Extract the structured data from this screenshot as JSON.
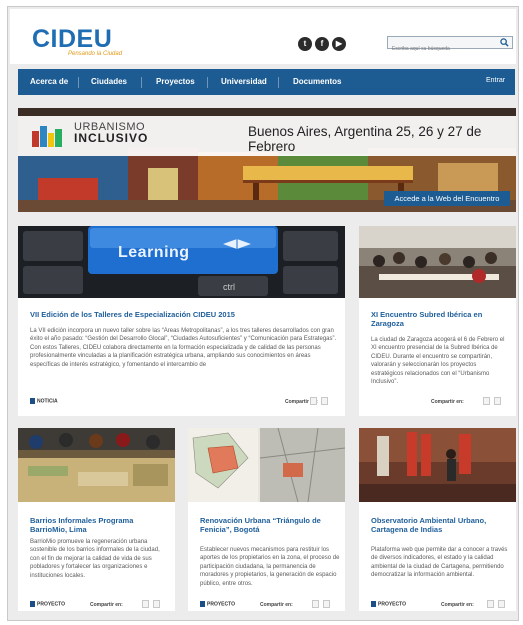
{
  "header": {
    "logo_text_a": "CI",
    "logo_text_b": "DEU",
    "tagline": "Pensando la Ciudad",
    "social": [
      "t",
      "f",
      "▶"
    ],
    "search_placeholder": "Escriba aquí su búsqueda"
  },
  "nav": {
    "items": [
      "Acerca de",
      "Ciudades",
      "Proyectos",
      "Universidad",
      "Documentos"
    ],
    "login": "Entrar"
  },
  "banner": {
    "line1": "URBANISMO",
    "line2": "INCLUSIVO",
    "location": "Buenos Aires, Argentina 25, 26 y 27 de Febrero",
    "cta": "Accede a la Web del Encuentro"
  },
  "cards": [
    {
      "image_text": "Learning",
      "image_key": "ctrl",
      "title": "VII Edición de los Talleres de Especialización CIDEU 2015",
      "desc": "La VII edición incorpora un nuevo taller sobre las “Áreas Metropolitanas”, a los tres talleres desarrollados con gran éxito el año pasado: “Gestión del Desarrollo Glocal”, “Ciudades Autosuficientes” y “Comunicación para Estrategas”. Con estos Talleres, CIDEU colabora directamente en la formación especializada y de calidad de las personas profesionalmente vinculadas a la planificación estratégica urbana, ampliando sus conocimientos en áreas específicas de interés estratégico, y fomentando el intercambio de",
      "tag": "NOTICIA",
      "share_label": "Compartir en:"
    },
    {
      "title": "XI Encuentro Subred Ibérica en Zaragoza",
      "desc": "La ciudad de Zaragoza acogerá el 6 de Febrero el XI encuentro presencial de la Subred Ibérica de CIDEU. Durante el encuentro se compartirán, valorarán y seleccionarán los proyectos estratégicos relacionados con el “Urbanismo Inclusivo”.",
      "tag": "",
      "share_label": "Compartir en:"
    },
    {
      "title": "Barrios Informales Programa BarrioMio, Lima",
      "desc": "BarrioMio promueve la regeneración urbana sostenible de los barrios informales de la ciudad, con el fin de mejorar la calidad de vida de sus pobladores y fortalecer las organizaciones e instituciones locales.",
      "tag": "PROYECTO",
      "share_label": "Compartir en:"
    },
    {
      "title": "Renovación Urbana “Triángulo de Fenicia”, Bogotá",
      "desc": "Establecer nuevos mecanismos para restituir los aportes de los propietarios en la zona, el proceso de participación ciudadana, la permanencia de moradores y propietarios, la generación de espacio público, entre otros.",
      "tag": "PROYECTO",
      "share_label": "Compartir en:"
    },
    {
      "title": "Observatorio Ambiental Urbano, Cartagena de Indias",
      "desc": "Plataforma web que permite dar a conocer a través de diversos indicadores, el estado y la calidad ambiental de la ciudad de Cartagena, permitiendo democratizar la información ambiental.",
      "tag": "PROYECTO",
      "share_label": "Compartir en:"
    }
  ]
}
